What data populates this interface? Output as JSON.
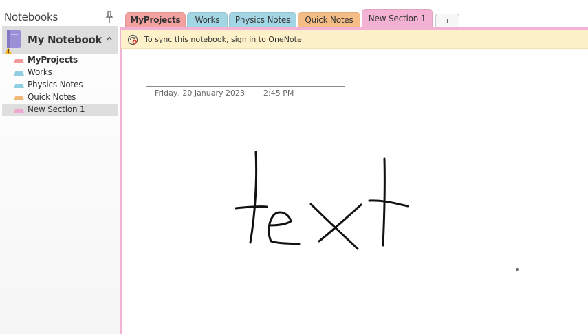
{
  "sidebar": {
    "title": "Notebooks",
    "notebook": {
      "name": "My Notebook",
      "color": "#9b8fd6"
    },
    "sections": [
      {
        "label": "MyProjects",
        "color": "#f29a9a",
        "bold": true,
        "selected": false
      },
      {
        "label": "Works",
        "color": "#8ecfe0",
        "bold": false,
        "selected": false
      },
      {
        "label": "Physics Notes",
        "color": "#8ecfe0",
        "bold": false,
        "selected": false
      },
      {
        "label": "Quick Notes",
        "color": "#f2b878",
        "bold": false,
        "selected": false
      },
      {
        "label": "New Section 1",
        "color": "#f0a8d0",
        "bold": false,
        "selected": true
      }
    ]
  },
  "tabs": [
    {
      "label": "MyProjects",
      "color": "#f4a1a1",
      "bold": true,
      "active": false
    },
    {
      "label": "Works",
      "color": "#a3d6e4",
      "bold": false,
      "active": false
    },
    {
      "label": "Physics Notes",
      "color": "#a3d6e4",
      "bold": false,
      "active": false
    },
    {
      "label": "Quick Notes",
      "color": "#f4bd86",
      "bold": false,
      "active": false
    },
    {
      "label": "New Section 1",
      "color": "#f3b1d4",
      "bold": false,
      "active": true
    }
  ],
  "add_tab_label": "+",
  "notification": {
    "text": "To sync this notebook, sign in to OneNote."
  },
  "page": {
    "date": "Friday, 20 January 2023",
    "time": "2:45 PM",
    "ink_text": "text"
  },
  "colors": {
    "active_section": "#f3b1d4",
    "notification_bg": "#fcf1c9"
  }
}
